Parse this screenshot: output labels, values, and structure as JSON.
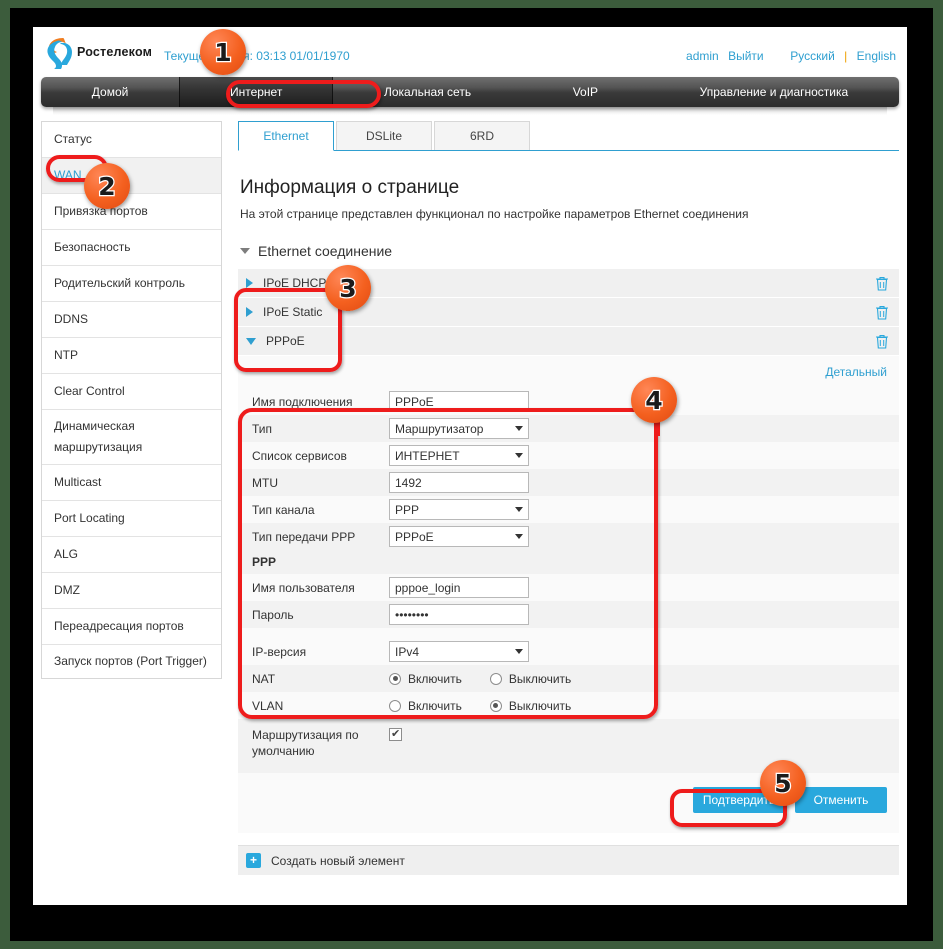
{
  "header": {
    "logo_text": "Ростелеком",
    "logo_icon": "rostelecom-logo-icon",
    "current_time": "Текущее время: 03:13 01/01/1970",
    "user": "admin",
    "logout": "Выйти",
    "lang_ru": "Русский",
    "lang_separator": "|",
    "lang_en": "English"
  },
  "nav": {
    "items": [
      {
        "label": "Домой",
        "active": false
      },
      {
        "label": "Интернет",
        "active": true
      },
      {
        "label": "Локальная сеть",
        "active": false
      },
      {
        "label": "VoIP",
        "active": false
      },
      {
        "label": "Управление и диагностика",
        "active": false
      }
    ]
  },
  "sidebar": {
    "items": [
      {
        "label": "Статус",
        "active": false
      },
      {
        "label": "WAN",
        "active": true
      },
      {
        "label": "Привязка портов",
        "active": false
      },
      {
        "label": "Безопасность",
        "active": false
      },
      {
        "label": "Родительский контроль",
        "active": false
      },
      {
        "label": "DDNS",
        "active": false
      },
      {
        "label": "NTP",
        "active": false
      },
      {
        "label": "Clear Control",
        "active": false
      },
      {
        "label": "Динамическая маршрутизация",
        "active": false
      },
      {
        "label": "Multicast",
        "active": false
      },
      {
        "label": "Port Locating",
        "active": false
      },
      {
        "label": "ALG",
        "active": false
      },
      {
        "label": "DMZ",
        "active": false
      },
      {
        "label": "Переадресация портов",
        "active": false
      },
      {
        "label": "Запуск портов (Port Trigger)",
        "active": false
      }
    ]
  },
  "tabs": [
    {
      "label": "Ethernet",
      "active": true
    },
    {
      "label": "DSLite",
      "active": false
    },
    {
      "label": "6RD",
      "active": false
    }
  ],
  "main": {
    "page_title": "Информация о странице",
    "page_desc": "На этой странице представлен функционал по настройке параметров Ethernet соединения",
    "section_title": "Ethernet соединение",
    "detail_link": "Детальный",
    "connections": [
      {
        "label": "IPoE DHCP",
        "expanded": false,
        "delete_icon": "trash-icon"
      },
      {
        "label": "IPoE Static",
        "expanded": false,
        "delete_icon": "trash-icon"
      },
      {
        "label": "PPPoE",
        "expanded": true,
        "delete_icon": "trash-icon"
      }
    ],
    "form": {
      "conn_name_label": "Имя подключения",
      "conn_name_value": "PPPoE",
      "type_label": "Тип",
      "type_value": "Маршрутизатор",
      "service_list_label": "Список сервисов",
      "service_list_value": "ИНТЕРНЕТ",
      "mtu_label": "MTU",
      "mtu_value": "1492",
      "channel_type_label": "Тип канала",
      "channel_type_value": "PPP",
      "ppp_transfer_label": "Тип передачи PPP",
      "ppp_transfer_value": "PPPoE",
      "ppp_section": "PPP",
      "username_label": "Имя пользователя",
      "username_value": "pppoe_login",
      "password_label": "Пароль",
      "password_value": "••••••••",
      "ipver_label": "IP-версия",
      "ipver_value": "IPv4",
      "nat_label": "NAT",
      "nat_on": "Включить",
      "nat_off": "Выключить",
      "nat_selected": "on",
      "vlan_label": "VLAN",
      "vlan_on": "Включить",
      "vlan_off": "Выключить",
      "vlan_selected": "off",
      "default_route_label": "Маршрутизация по умолчанию",
      "default_route_checked": true
    },
    "buttons": {
      "confirm": "Подтвердить",
      "cancel": "Отменить"
    },
    "create_new": "Создать новый элемент",
    "create_icon": "plus-icon"
  },
  "annotations": {
    "badges": [
      "1",
      "2",
      "3",
      "4",
      "5"
    ],
    "highlight_color": "#ee1c1c",
    "badge_color": "#f4601f"
  }
}
